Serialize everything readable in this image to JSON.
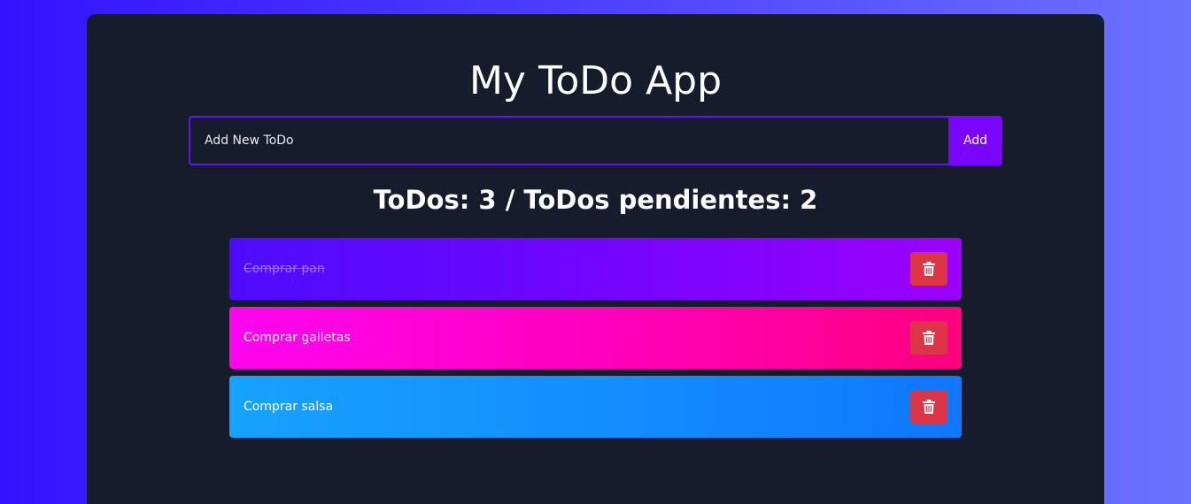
{
  "app": {
    "title": "My ToDo App"
  },
  "add_form": {
    "placeholder": "Add New ToDo",
    "value": "",
    "button_label": "Add"
  },
  "counter": {
    "text": "ToDos: 3 / ToDos pendientes: 2"
  },
  "todos": [
    {
      "label": "Comprar pan",
      "done": true,
      "delete_icon": "trash-icon"
    },
    {
      "label": "Comprar galletas",
      "done": false,
      "delete_icon": "trash-icon"
    },
    {
      "label": "Comprar salsa",
      "done": false,
      "delete_icon": "trash-icon"
    }
  ],
  "colors": {
    "background_start": "#3512ff",
    "background_end": "#6b72ff",
    "card": "#171c2c",
    "accent": "#7a05ff",
    "delete": "#dc3545"
  }
}
